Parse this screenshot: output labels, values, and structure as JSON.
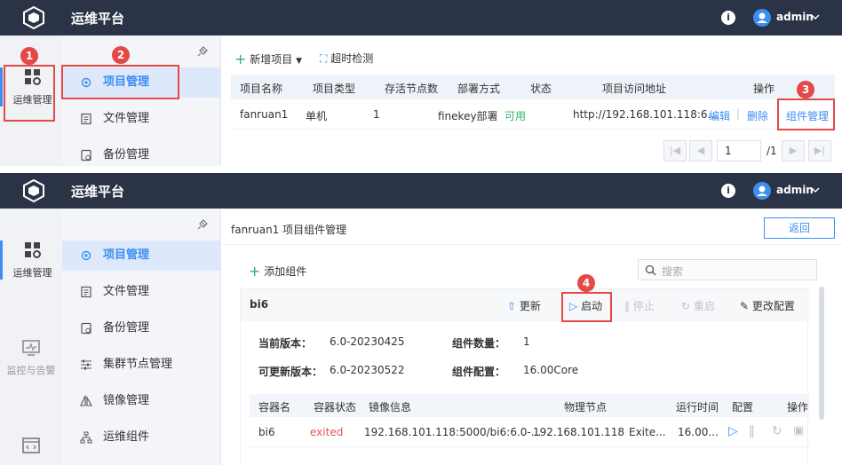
{
  "app": {
    "title": "运维平台",
    "username": "admin",
    "info_glyph": "i"
  },
  "rail": {
    "ops": "运维管理",
    "monitor": "监控与告警"
  },
  "menu": {
    "project": "项目管理",
    "file": "文件管理",
    "backup": "备份管理",
    "cluster": "集群节点管理",
    "image": "镜像管理",
    "component": "运维组件"
  },
  "panel1": {
    "toolbar": {
      "add_project": "新增项目",
      "timeout_check": "超时检测"
    },
    "table": {
      "headers": [
        "项目名称",
        "项目类型",
        "存活节点数",
        "部署方式",
        "状态",
        "项目访问地址",
        "操作"
      ],
      "row": {
        "name": "fanruan1",
        "type": "单机",
        "alive": "1",
        "deploy": "finekey部署",
        "status": "可用",
        "url": "http://192.168.101.118:6...",
        "edit": "编辑",
        "sep": "|",
        "delete": "删除",
        "manage": "组件管理"
      }
    },
    "pager": {
      "page": "1",
      "total": "/1"
    }
  },
  "panel2": {
    "breadcrumb": "fanruan1 项目组件管理",
    "return": "返回",
    "add_component": "添加组件",
    "search_placeholder": "搜索",
    "card": {
      "name": "bi6",
      "actions": {
        "update": "更新",
        "start": "启动",
        "stop": "停止",
        "restart": "重启",
        "config": "更改配置"
      },
      "current_version_label": "当前版本：",
      "current_version": "6.0-20230425",
      "updatable_version_label": "可更新版本：",
      "updatable_version": "6.0-20230522",
      "component_count_label": "组件数量：",
      "component_count": "1",
      "component_config_label": "组件配置：",
      "component_config": "16.00Core",
      "headers": [
        "容器名",
        "容器状态",
        "镜像信息",
        "物理节点",
        "运行时间",
        "配置",
        "操作"
      ],
      "row": {
        "container": "bi6",
        "state": "exited",
        "image": "192.168.101.118:5000/bi6:6.0-...",
        "node": "192.168.101.118",
        "uptime": "Exite...",
        "config": "16.00..."
      }
    }
  },
  "badges": {
    "b1": "1",
    "b2": "2",
    "b3": "3",
    "b4": "4"
  },
  "colors": {
    "topbar": "#2b3447",
    "accent": "#3d8ef0",
    "highlight": "#e54848",
    "available": "#2db36b",
    "exited": "#e45555"
  }
}
